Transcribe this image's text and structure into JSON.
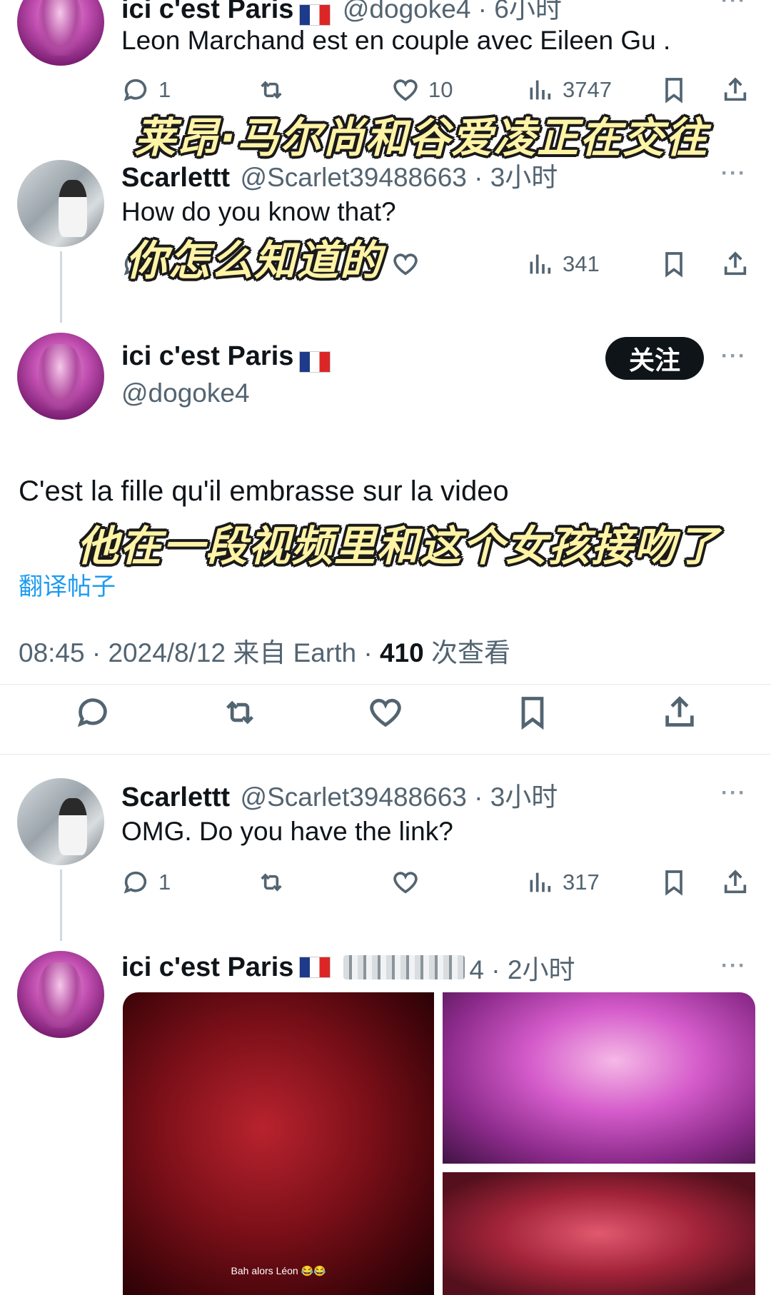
{
  "tweet1": {
    "name": "ici c'est Paris",
    "handle_time": "@dogoke4 · 6小时",
    "text": "Leon Marchand est en couple avec Eileen Gu .",
    "replies": "1",
    "likes": "10",
    "views": "3747",
    "caption": "莱昂·马尔尚和谷爱凌正在交往"
  },
  "tweet2": {
    "name": "Scarlettt",
    "handle_time": "@Scarlet39488663 · 3小时",
    "text": "How do you know that?",
    "views": "341",
    "caption": "你怎么知道的"
  },
  "main_tweet": {
    "name": "ici c'est Paris",
    "handle": "@dogoke4",
    "follow_label": "关注",
    "text": "C'est la fille qu'il embrasse sur la video",
    "caption": "他在一段视频里和这个女孩接吻了",
    "translate_label": "翻译帖子",
    "timestamp": "08:45 · 2024/8/12 来自 Earth · ",
    "view_count": "410",
    "view_label": " 次查看"
  },
  "tweet3": {
    "name": "Scarlettt",
    "handle_time": "@Scarlet39488663 · 3小时",
    "text": "OMG. Do you have the link?",
    "replies": "1",
    "views": "317"
  },
  "tweet4": {
    "name": "ici c'est Paris",
    "time": "4 · 2小时",
    "media_caption": "Bah alors Léon 😂😂"
  },
  "more_label": "···",
  "icons": [
    "reply-icon",
    "retweet-icon",
    "like-icon",
    "views-icon",
    "bookmark-icon",
    "share-icon",
    "more-icon"
  ],
  "colors": {
    "text": "#0f1419",
    "meta": "#536471",
    "link": "#1d9bf0",
    "caption": "#fff3a6"
  }
}
